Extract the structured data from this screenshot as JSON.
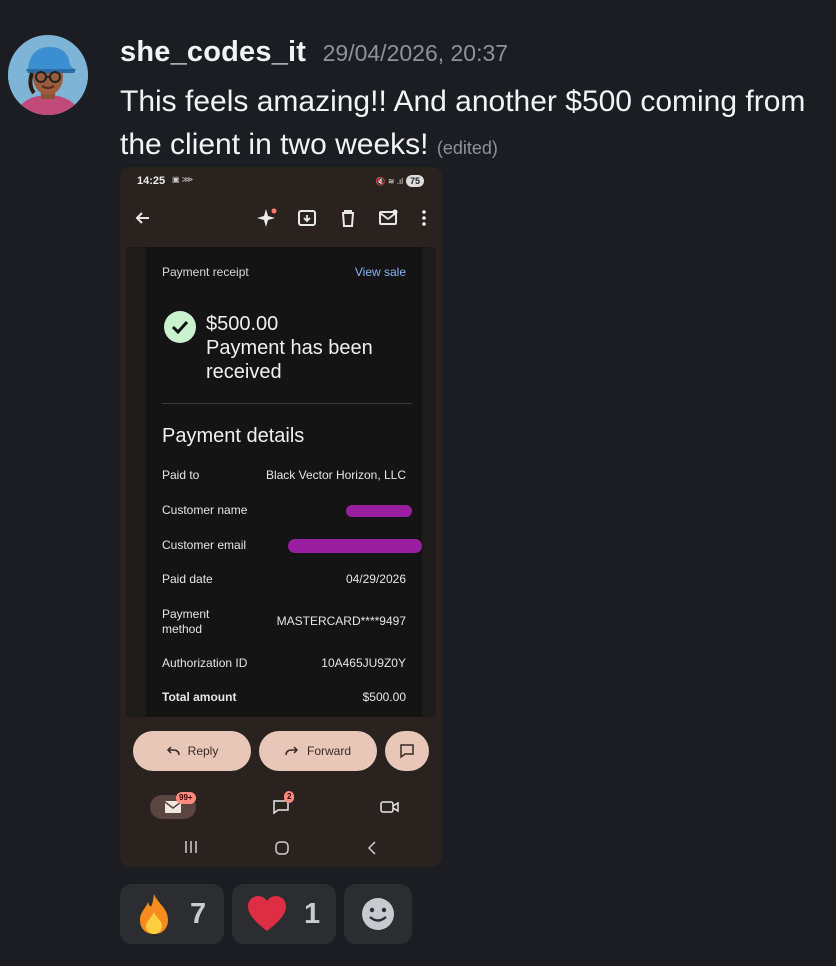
{
  "message": {
    "username": "she_codes_it",
    "timestamp": "29/04/2026, 20:37",
    "text": "This feels amazing!! And another $500 coming from the client in two weeks!",
    "edited_label": "(edited)"
  },
  "phone": {
    "status_time": "14:25",
    "battery": "75",
    "receipt_label": "Payment receipt",
    "view_sale_link": "View sale",
    "amount": "$500.00",
    "received_text": "Payment has been received",
    "details_title": "Payment details",
    "details": [
      {
        "label": "Paid to",
        "value": "Black Vector Horizon, LLC"
      },
      {
        "label": "Customer name",
        "value": ""
      },
      {
        "label": "Customer email",
        "value": ""
      },
      {
        "label": "Paid date",
        "value": "04/29/2026"
      },
      {
        "label": "Payment method",
        "value": "MASTERCARD****9497"
      },
      {
        "label": "Authorization ID",
        "value": "10A465JU9Z0Y"
      },
      {
        "label": "Total amount",
        "value": "$500.00"
      }
    ],
    "reply_label": "Reply",
    "forward_label": "Forward",
    "mail_badge": "99+",
    "chat_badge": "2"
  },
  "reactions": [
    {
      "emoji": "fire",
      "count": "7"
    },
    {
      "emoji": "heart",
      "count": "1"
    }
  ],
  "colors": {
    "background": "#1c1d22",
    "redaction": "#9a1fa0",
    "link": "#8ab4f8",
    "pill": "#e8c7b9"
  }
}
